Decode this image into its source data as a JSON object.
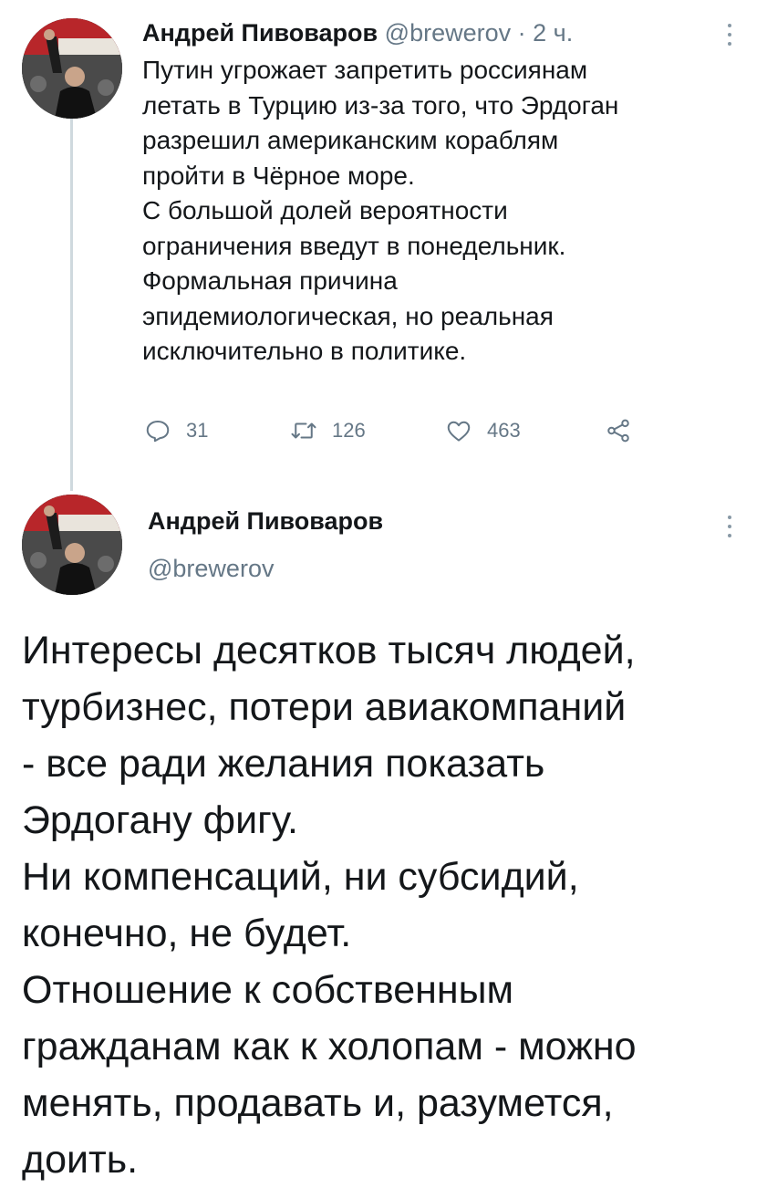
{
  "tweet1": {
    "author_name": "Андрей Пивоваров",
    "handle": "@brewerov",
    "separator": " · ",
    "time": "2 ч.",
    "text": "Путин угрожает запретить россиянам\nлетать в Турцию из-за того, что Эрдоган\nразрешил американским кораблям\nпройти в Чёрное море.\nС большой долей вероятности\nограничения введут в понедельник.\nФормальная причина\nэпидемиологическая, но реальная\nисключительно в политике.",
    "stats": {
      "replies": "31",
      "retweets": "126",
      "likes": "463"
    },
    "icons": [
      "reply-icon",
      "retweet-icon",
      "like-icon",
      "share-icon",
      "more-icon"
    ]
  },
  "tweet2": {
    "author_name": "Андрей Пивоваров",
    "handle": "@brewerov",
    "text": "Интересы десятков тысяч людей,\nтурбизнес, потери авиакомпаний\n- все ради желания показать\nЭрдогану фигу.\nНи компенсаций, ни субсидий,\nконечно, не будет.\nОтношение к собственным\nгражданам как к холопам - можно\nменять, продавать и, разумется,\nдоить."
  },
  "colors": {
    "text": "#14171a",
    "secondary": "#657786",
    "thread_line": "#cfd9de"
  }
}
